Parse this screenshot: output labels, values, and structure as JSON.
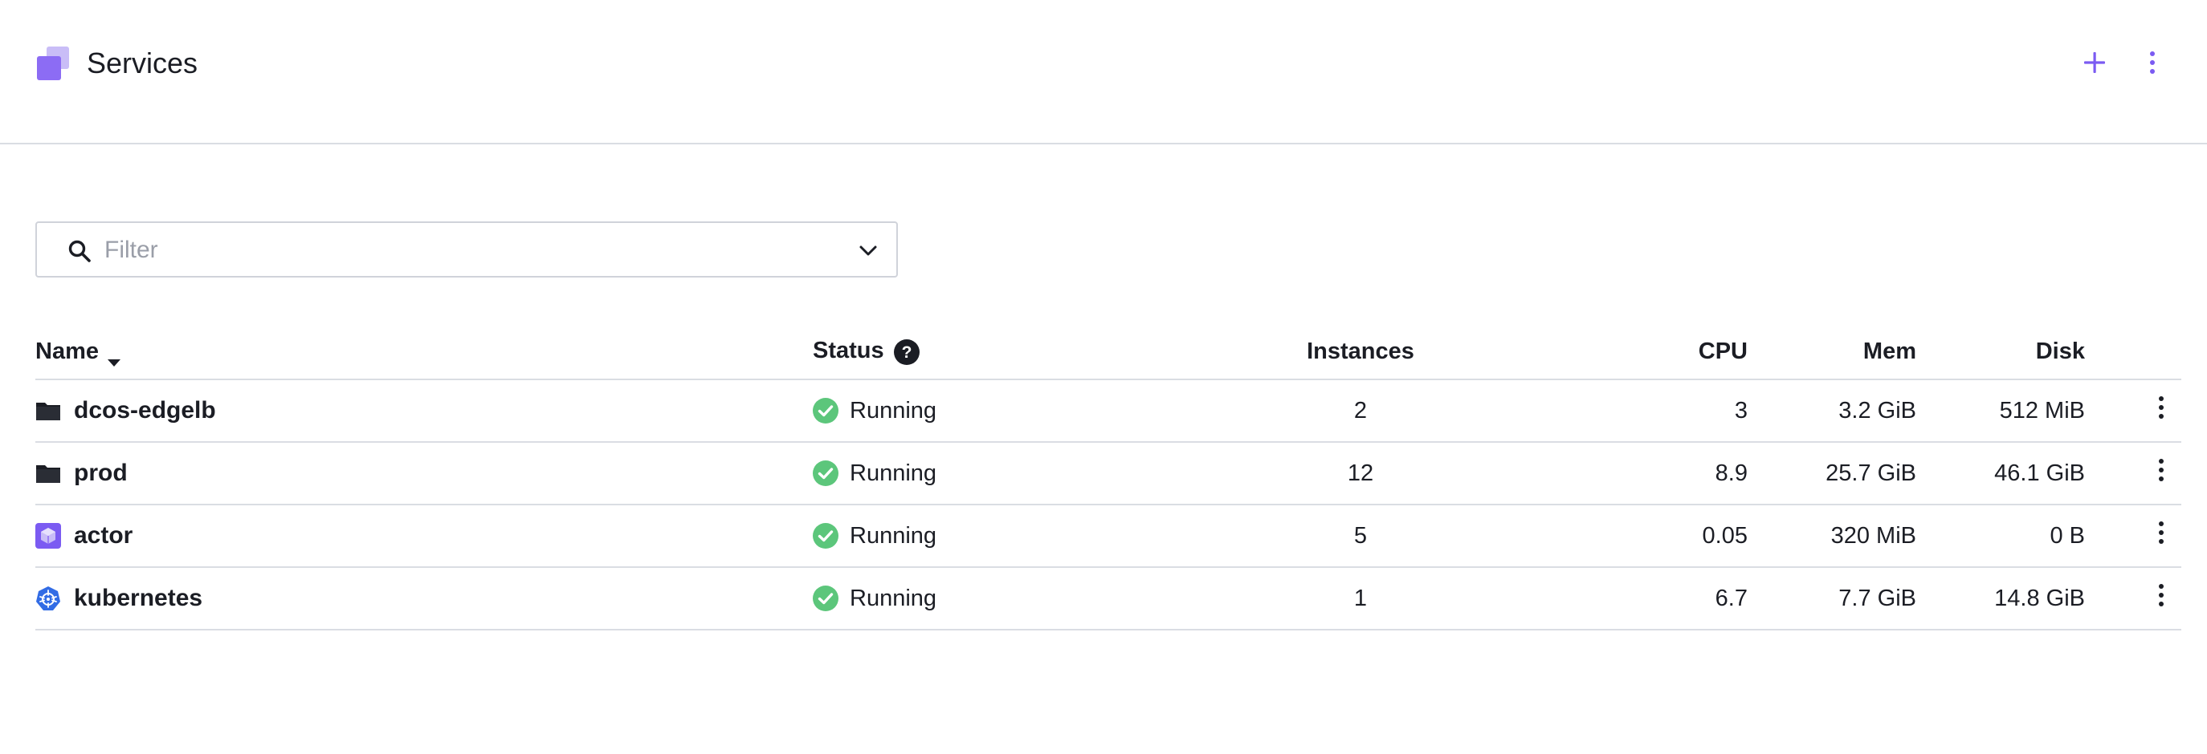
{
  "header": {
    "title": "Services",
    "logo_icon": "services-logo-icon",
    "add_icon": "plus-icon",
    "more_icon": "kebab-icon",
    "accent_color": "#7b5bf2"
  },
  "filter": {
    "placeholder": "Filter",
    "value": "",
    "search_icon": "search-icon",
    "dropdown_icon": "chevron-down-icon"
  },
  "table": {
    "columns": {
      "name": "Name",
      "status": "Status",
      "instances": "Instances",
      "cpu": "CPU",
      "mem": "Mem",
      "disk": "Disk"
    },
    "sort": {
      "column": "Name",
      "direction": "descending",
      "icon": "caret-down-icon"
    },
    "status_help_icon": "question-circle-icon",
    "rows": [
      {
        "icon": "folder-icon",
        "name": "dcos-edgelb",
        "status": "Running",
        "status_icon": "check-circle-icon",
        "instances": "2",
        "cpu": "3",
        "mem": "3.2 GiB",
        "disk": "512 MiB"
      },
      {
        "icon": "folder-icon",
        "name": "prod",
        "status": "Running",
        "status_icon": "check-circle-icon",
        "instances": "12",
        "cpu": "8.9",
        "mem": "25.7 GiB",
        "disk": "46.1 GiB"
      },
      {
        "icon": "package-icon",
        "name": "actor",
        "status": "Running",
        "status_icon": "check-circle-icon",
        "instances": "5",
        "cpu": "0.05",
        "mem": "320 MiB",
        "disk": "0 B"
      },
      {
        "icon": "kubernetes-icon",
        "name": "kubernetes",
        "status": "Running",
        "status_icon": "check-circle-icon",
        "instances": "1",
        "cpu": "6.7",
        "mem": "7.7 GiB",
        "disk": "14.8 GiB"
      }
    ]
  },
  "colors": {
    "status_running": "#5cc67b",
    "text": "#1b1d24",
    "border": "#dadde3",
    "placeholder": "#9a9ea8"
  }
}
